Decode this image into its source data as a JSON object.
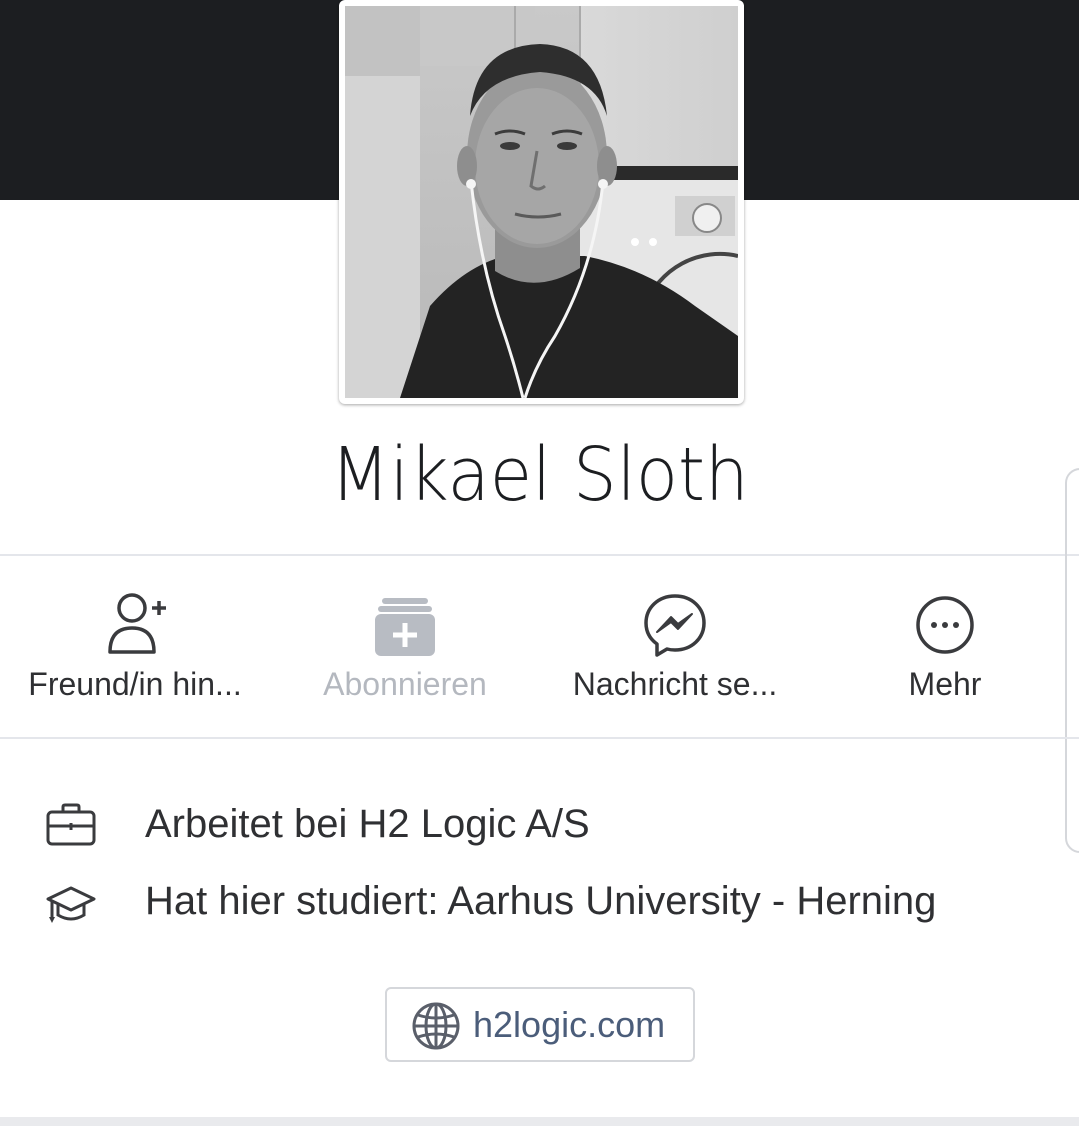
{
  "profile": {
    "name": "Mikael Sloth",
    "photo_alt": "profile photo"
  },
  "actions": [
    {
      "label": "Freund/in hin...",
      "icon": "add-friend-icon",
      "enabled": true
    },
    {
      "label": "Abonnieren",
      "icon": "follow-icon",
      "enabled": false
    },
    {
      "label": "Nachricht se...",
      "icon": "messenger-icon",
      "enabled": true
    },
    {
      "label": "Mehr",
      "icon": "more-icon",
      "enabled": true
    }
  ],
  "info": {
    "work": {
      "text": "Arbeitet bei H2 Logic A/S",
      "icon": "briefcase-icon"
    },
    "education": {
      "text": "Hat hier studiert: Aarhus University - Herning",
      "icon": "graduation-cap-icon"
    }
  },
  "website": {
    "text": "h2logic.com",
    "icon": "globe-icon"
  },
  "colors": {
    "cover": "#1c1e21",
    "text": "#2f3033",
    "disabled": "#b4b8bf",
    "link": "#4b5d7a",
    "divider": "#e4e6eb"
  }
}
